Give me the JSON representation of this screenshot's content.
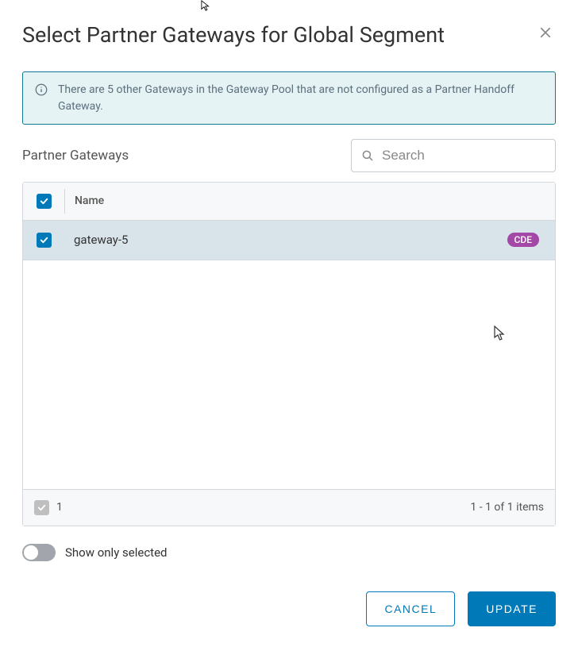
{
  "modal": {
    "title": "Select Partner Gateways for Global Segment",
    "info_message": "There are 5 other Gateways in the Gateway Pool that are not configured as a Partner Handoff Gateway."
  },
  "section": {
    "title": "Partner Gateways"
  },
  "search": {
    "placeholder": "Search",
    "value": ""
  },
  "table": {
    "header_name": "Name",
    "rows": [
      {
        "name": "gateway-5",
        "badge": "CDE",
        "selected": true
      }
    ],
    "footer_count": "1",
    "footer_range": "1 - 1 of 1 items"
  },
  "toggle": {
    "label": "Show only selected",
    "on": false
  },
  "buttons": {
    "cancel": "CANCEL",
    "update": "UPDATE"
  }
}
